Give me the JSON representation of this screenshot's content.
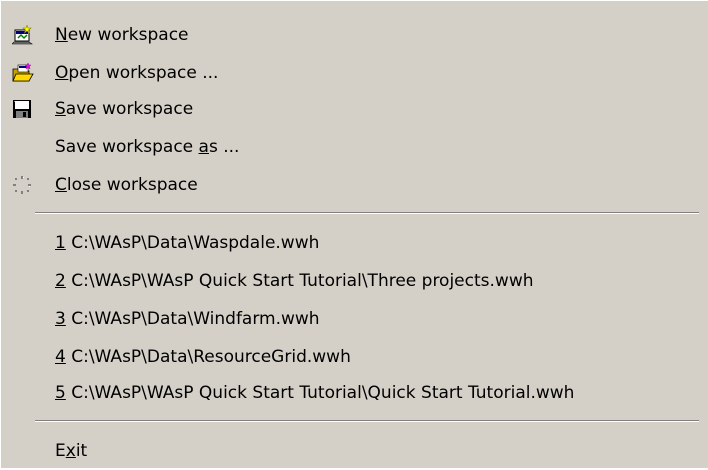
{
  "menu": {
    "items": [
      {
        "mnemonic": "N",
        "rest": "ew workspace",
        "icon": "new-workspace-icon"
      },
      {
        "mnemonic": "O",
        "rest": "pen workspace ...",
        "icon": "open-folder-icon"
      },
      {
        "mnemonic": "S",
        "rest": "ave workspace",
        "icon": "floppy-disk-icon"
      },
      {
        "pre": "Save workspace ",
        "mnemonic": "a",
        "rest": "s ..."
      },
      {
        "mnemonic": "C",
        "rest": "lose workspace",
        "icon": "close-workspace-icon"
      }
    ],
    "recent_files": [
      {
        "mnemonic": "1",
        "path": " C:\\WAsP\\Data\\Waspdale.wwh"
      },
      {
        "mnemonic": "2",
        "path": " C:\\WAsP\\WAsP Quick Start Tutorial\\Three projects.wwh"
      },
      {
        "mnemonic": "3",
        "path": " C:\\WAsP\\Data\\Windfarm.wwh"
      },
      {
        "mnemonic": "4",
        "path": " C:\\WAsP\\Data\\ResourceGrid.wwh"
      },
      {
        "mnemonic": "5",
        "path": " C:\\WAsP\\WAsP Quick Start Tutorial\\Quick Start Tutorial.wwh"
      }
    ],
    "exit": {
      "pre": "E",
      "mnemonic": "x",
      "rest": "it"
    }
  },
  "colors": {
    "menu_background": "#d4d0c8",
    "separator_dark": "#808080",
    "separator_light": "#ffffff",
    "text": "#000000"
  }
}
